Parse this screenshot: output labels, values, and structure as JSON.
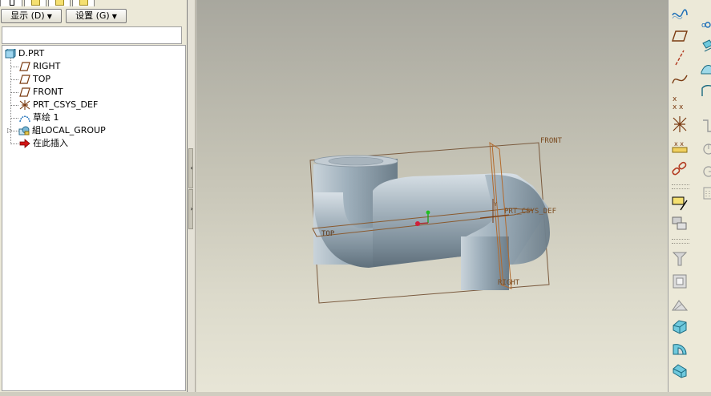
{
  "left_panel": {
    "buttons": {
      "show_label": "显示 (D)",
      "settings_label": "设置 (G)"
    },
    "tree": {
      "root": "D.PRT",
      "items": [
        {
          "label": "RIGHT",
          "icon": "datum-plane-icon"
        },
        {
          "label": "TOP",
          "icon": "datum-plane-icon"
        },
        {
          "label": "FRONT",
          "icon": "datum-plane-icon"
        },
        {
          "label": "PRT_CSYS_DEF",
          "icon": "coordinate-system-icon"
        },
        {
          "label": "草绘 1",
          "icon": "sketch-icon"
        },
        {
          "label": "組LOCAL_GROUP",
          "icon": "local-group-icon"
        },
        {
          "label": "在此插入",
          "icon": "insert-here-arrow-icon"
        }
      ]
    }
  },
  "viewport": {
    "labels": {
      "front": "FRONT",
      "top": "TOP",
      "right": "RIGHT",
      "csys": "PRT_CSYS_DEF",
      "y_axis": "Y"
    }
  },
  "colors": {
    "datum": "#a3612a",
    "part": "#9aa9b3",
    "accent": "#1d6fb8"
  },
  "right_toolbar": {
    "icons": [
      "datum-curve-wave-icon",
      "datum-plane-tool-icon",
      "datum-axis-icon",
      "sketched-curve-icon",
      "datum-point-icon",
      "coordinate-system-tool-icon",
      "analysis-tool-icon",
      "chain-link-icon",
      "sketch-tool-icon",
      "copy-tool-icon",
      "trim-tool-icon",
      "shell-tool-icon",
      "draft-tool-icon",
      "extrude-tool-icon",
      "revolve-tool-icon",
      "sweep-tool-icon",
      "point-offset-icon",
      "move-tool-icon",
      "surface-tool-icon",
      "boundary-tool-icon",
      "round-tool-icon",
      "chamfer-tool-icon",
      "rib-tool-icon",
      "pattern-tool-icon"
    ]
  }
}
